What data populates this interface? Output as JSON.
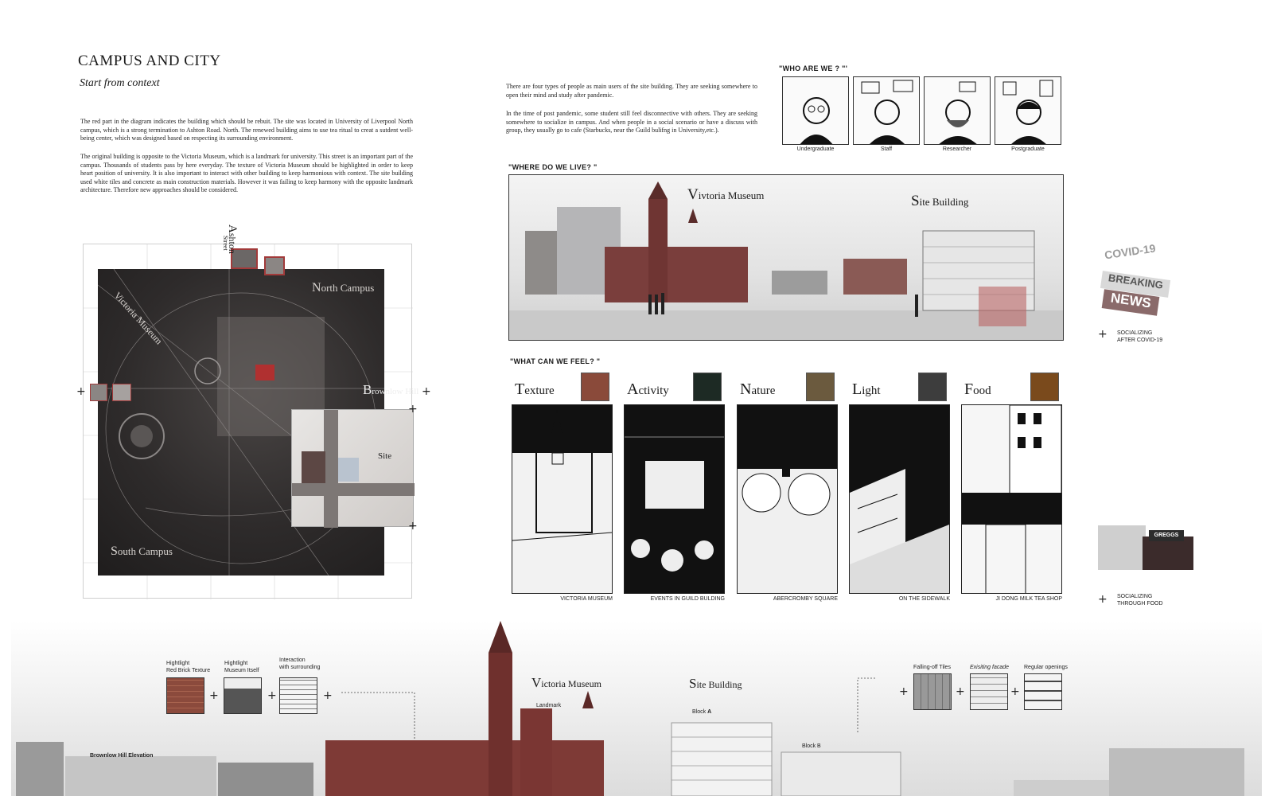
{
  "header": {
    "title": "CAMPUS AND CITY",
    "subtitle": "Start from context",
    "paragraph1": "The red part in the diagram indicates the building which should be rebuit. The site was located in University of Liverpool North campus, which is a strong termination to Ashton Road. North. The renewed building aims to use tea ritual to creat a sutdent well-being center, which was designed based on respecting its surrounding environment.",
    "paragraph2": "The original building is opposite to the Victoria Museum, which is a landmark for university. This street is an important part of the campus. Thousands of students pass by here everyday. The texture of Victoria Museum should be highlighted in order to keep heart position of university. It is also important to interact with other building to keep harmonious with context. The site building used white tiles and concrete as main construction materials. However it was failing to keep harmony with the opposite landmark architecture. Therefore new approaches should be considered."
  },
  "map": {
    "ashton_first": "A",
    "ashton_rest": "shton",
    "street": "Street",
    "victoria": "Victoria Museum",
    "north_first": "N",
    "north_rest": "orth Campus",
    "brownlow_first": "B",
    "brownlow_rest": "rownlow Hill",
    "south_first": "S",
    "south_rest": "outh Campus",
    "site": "Site",
    "plus": "+"
  },
  "intro": {
    "p1": "There are four types of people as main users of the site building. They are seeking somewhere to open their mind and study after pandemic.",
    "p2": "In the time of post pandemic, some student still feel disconnective with others. They are seeking somewhere to socialize in campus. And  when people in a social scenario or have a discuss with group, they usually go to cafe (Starbucks, near the Guild bulifng in University,etc.)."
  },
  "who": {
    "heading": "\"WHO ARE WE ? \"'",
    "people": [
      "Undergraduate",
      "Staff",
      "Researcher",
      "Postgraduate"
    ]
  },
  "where": {
    "heading": "\"WHERE DO WE LIVE? \"",
    "victoria_first": "V",
    "victoria_rest": "ivtoria Museum",
    "site_first": "S",
    "site_rest": "ite Building"
  },
  "covid": {
    "label1": "SOCIALIZING",
    "label2": "AFTER COVID-19",
    "stamp": "COVID-19",
    "news1": "BREAKING",
    "news2": "NEWS"
  },
  "feel": {
    "heading": "\"WHAT CAN WE FEEL? \"",
    "panels": [
      {
        "first": "T",
        "rest": "exture",
        "caption": "VICTORIA MUSEUM"
      },
      {
        "first": "A",
        "rest": "ctivity",
        "caption": "EVENTS IN GUILD BULDING"
      },
      {
        "first": "N",
        "rest": "ature",
        "caption": "ABERCROMBY SQUARE"
      },
      {
        "first": "L",
        "rest": "ight",
        "caption": "ON THE SIDEWALK"
      },
      {
        "first": "F",
        "rest": "ood",
        "caption": "JI DONG MILK TEA SHOP"
      }
    ]
  },
  "food": {
    "label1": "SOCIALIZING",
    "label2": "THROUGH FOOD",
    "shop": "GREGGS"
  },
  "elevation": {
    "h1a": "Hightlight",
    "h1b": "Red Brick Texture",
    "h2a": "Hightlight",
    "h2b": "Museum Itself",
    "h3a": "Interaction",
    "h3b": "with surrounding",
    "victoria_first": "V",
    "victoria_rest": "ictoria Museum",
    "landmark": "Landmark",
    "site_first": "S",
    "site_rest": "ite Building",
    "block_a_prefix": "Block ",
    "block_a": "A",
    "block_b": "Block B",
    "brownlow": "Brownlow Hill Elevation",
    "tiles": "Falling-off Tiles",
    "facade": "Exisiting facade",
    "openings": "Regular openings",
    "plus": "+"
  }
}
